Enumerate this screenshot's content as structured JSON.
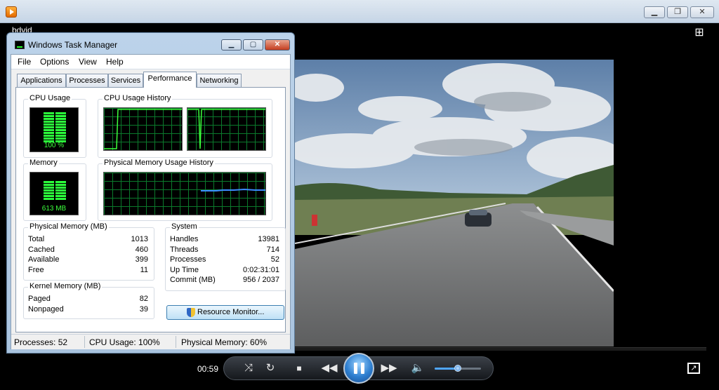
{
  "player": {
    "video_title": "bdvid",
    "current_time": "00:59",
    "volume_level": 0.5,
    "colors": {
      "accent": "#2e7fd0",
      "background": "#000000"
    }
  },
  "task_manager": {
    "title": "Windows Task Manager",
    "menu": [
      "File",
      "Options",
      "View",
      "Help"
    ],
    "tabs": [
      "Applications",
      "Processes",
      "Services",
      "Performance",
      "Networking"
    ],
    "active_tab": "Performance",
    "cpu_usage": {
      "label": "CPU Usage",
      "value": "100 %"
    },
    "cpu_history": {
      "label": "CPU Usage History"
    },
    "memory": {
      "label": "Memory",
      "value": "613 MB"
    },
    "memory_history": {
      "label": "Physical Memory Usage History"
    },
    "physical_memory": {
      "label": "Physical Memory (MB)",
      "rows": [
        {
          "k": "Total",
          "v": "1013"
        },
        {
          "k": "Cached",
          "v": "460"
        },
        {
          "k": "Available",
          "v": "399"
        },
        {
          "k": "Free",
          "v": "11"
        }
      ]
    },
    "system": {
      "label": "System",
      "rows": [
        {
          "k": "Handles",
          "v": "13981"
        },
        {
          "k": "Threads",
          "v": "714"
        },
        {
          "k": "Processes",
          "v": "52"
        },
        {
          "k": "Up Time",
          "v": "0:02:31:01"
        },
        {
          "k": "Commit (MB)",
          "v": "956 / 2037"
        }
      ]
    },
    "kernel_memory": {
      "label": "Kernel Memory (MB)",
      "rows": [
        {
          "k": "Paged",
          "v": "82"
        },
        {
          "k": "Nonpaged",
          "v": "39"
        }
      ]
    },
    "resource_monitor_button": "Resource Monitor...",
    "status": {
      "processes": "Processes: 52",
      "cpu": "CPU Usage: 100%",
      "memory": "Physical Memory: 60%"
    }
  }
}
